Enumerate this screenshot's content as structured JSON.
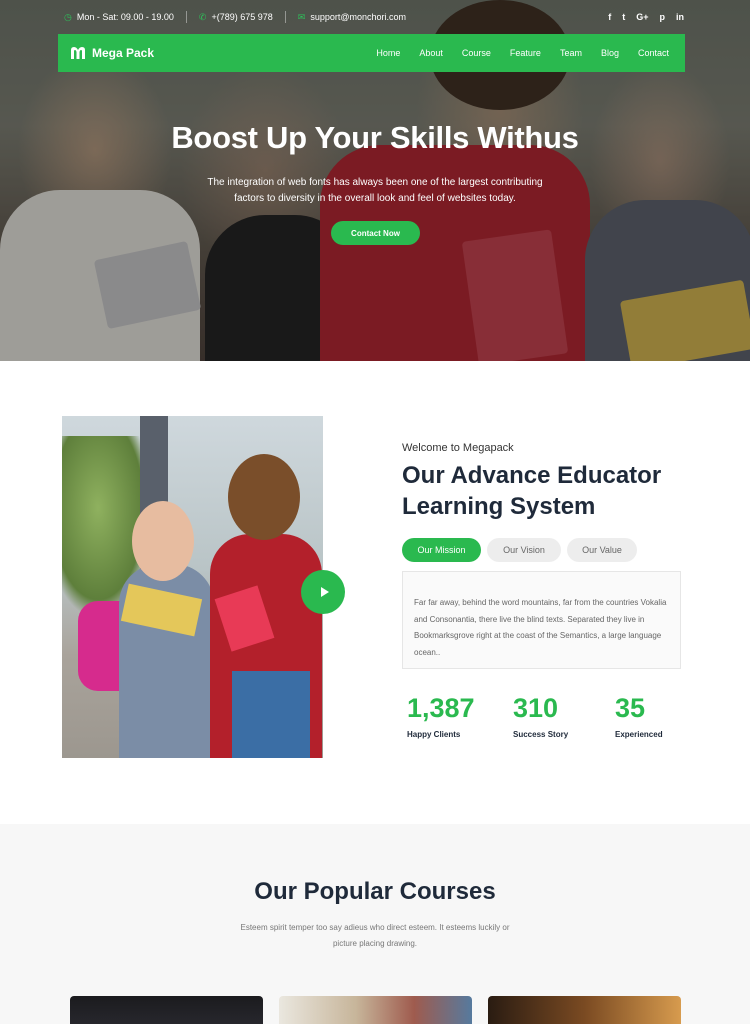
{
  "topbar": {
    "hours": "Mon - Sat: 09.00 - 19.00",
    "phone": "+(789) 675 978",
    "email": "support@monchori.com",
    "social": [
      "f",
      "t",
      "G+",
      "p",
      "in"
    ]
  },
  "nav": {
    "brand": "Mega Pack",
    "links": [
      "Home",
      "About",
      "Course",
      "Feature",
      "Team",
      "Blog",
      "Contact"
    ]
  },
  "hero": {
    "title": "Boost Up Your Skills Withus",
    "subtitle": "The integration of web fonts has always been one of the largest contributing factors to diversity in the overall look and feel of websites today.",
    "button": "Contact Now"
  },
  "about": {
    "eyebrow": "Welcome to Megapack",
    "title": "Our Advance Educator Learning System",
    "tabs": [
      {
        "label": "Our Mission",
        "active": true
      },
      {
        "label": "Our Vision",
        "active": false
      },
      {
        "label": "Our Value",
        "active": false
      }
    ],
    "panel_text": "Far far away, behind the word mountains, far from the countries Vokalia and Consonantia, there live the blind texts. Separated they live in Bookmarksgrove right at the coast of the Semantics, a large language ocean..",
    "stats": [
      {
        "value": "1,387",
        "label": "Happy Clients"
      },
      {
        "value": "310",
        "label": "Success Story"
      },
      {
        "value": "35",
        "label": "Experienced"
      }
    ]
  },
  "courses": {
    "title": "Our Popular Courses",
    "subtitle": "Esteem spirit temper too say adieus who direct esteem. It esteems luckily or picture placing drawing."
  },
  "colors": {
    "accent": "#2ab94f",
    "heading": "#1f2a3a"
  }
}
